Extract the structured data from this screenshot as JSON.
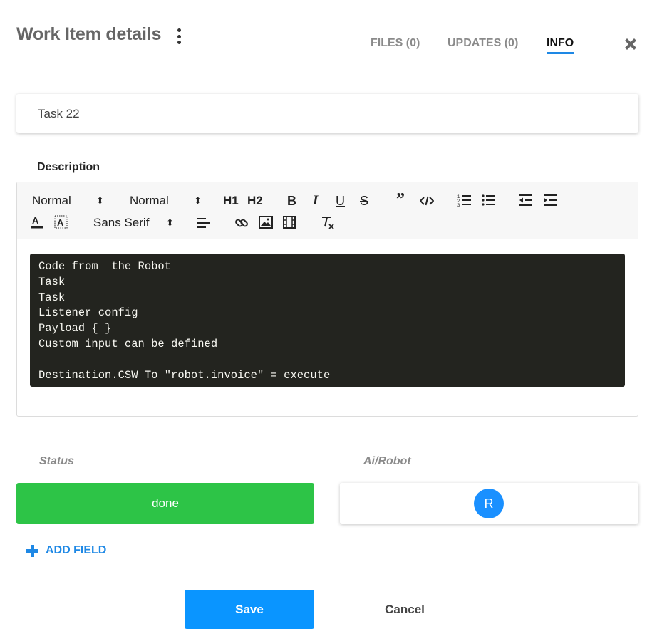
{
  "header": {
    "title": "Work Item details",
    "tabs": [
      {
        "label": "FILES (0)",
        "active": false
      },
      {
        "label": "UPDATES (0)",
        "active": false
      },
      {
        "label": "INFO",
        "active": true
      }
    ],
    "accent_color": "#1e88e5"
  },
  "work_item": {
    "name": "Task 22"
  },
  "description": {
    "label": "Description",
    "toolbar": {
      "header_select": "Normal",
      "size_select": "Normal",
      "font_select": "Sans Serif",
      "h1": "H1",
      "h2": "H2",
      "bold": "B",
      "italic": "I",
      "underline": "U",
      "strike": "S",
      "blockquote": "”"
    },
    "code_lines": [
      "Code from  the Robot",
      "Task",
      "Task",
      "Listener config",
      "Payload { }",
      "Custom input can be defined",
      "",
      "Destination.CSW To \"robot.invoice\" = execute"
    ],
    "code_bg": "#23241f"
  },
  "fields": {
    "status": {
      "label": "Status",
      "value": "done",
      "color": "#2dc447"
    },
    "robot": {
      "label": "Ai/Robot",
      "avatar_initial": "R",
      "avatar_color": "#1a90ff"
    },
    "add_field_label": "ADD FIELD"
  },
  "actions": {
    "save_label": "Save",
    "cancel_label": "Cancel",
    "save_color": "#0a95ff"
  }
}
